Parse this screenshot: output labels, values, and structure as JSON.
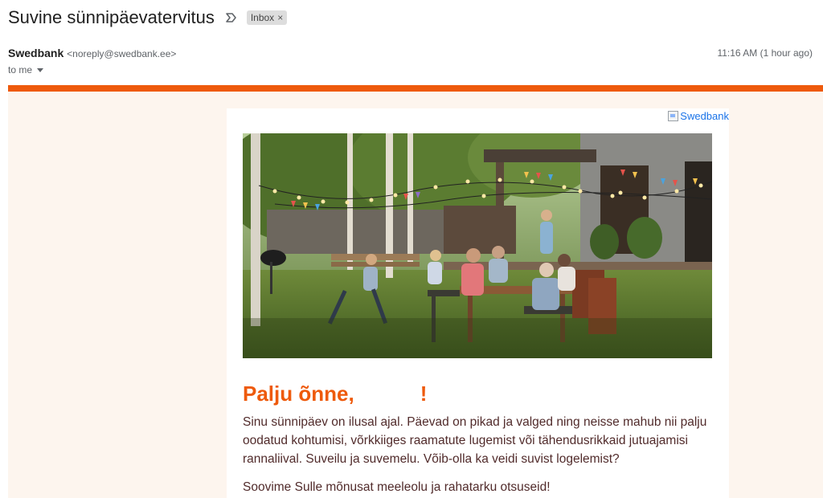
{
  "email": {
    "subject": "Suvine sünnipäevatervitus",
    "labels": [
      "Inbox"
    ],
    "sender_name": "Swedbank",
    "sender_email": "<noreply@swedbank.ee>",
    "time": "11:16 AM (1 hour ago)",
    "recipient": "to me"
  },
  "content": {
    "logo_alt": "Swedbank",
    "greeting": "Palju õnne,",
    "greeting_end": "!",
    "paragraph1": "Sinu sünnipäev on ilusal ajal. Päevad on pikad ja valged ning neisse mahub nii palju oodatud kohtumisi, võrkkiiges raamatute lugemist või tähendusrikkaid jutuajamisi rannaliival. Suveilu ja suvemelu. Võib-olla ka veidi suvist logelemist?",
    "paragraph2": "Soovime Sulle mõnusat meeleolu ja rahatarku otsuseid!"
  },
  "colors": {
    "brand_orange": "#ee5a0c",
    "email_bg": "#fdf5ee",
    "body_text": "#512b2b"
  },
  "icons": {
    "label_icon": "label-arrow-icon",
    "remove_label": "close-icon",
    "recipient_details": "chevron-down-icon",
    "broken_image": "broken-image-icon"
  }
}
